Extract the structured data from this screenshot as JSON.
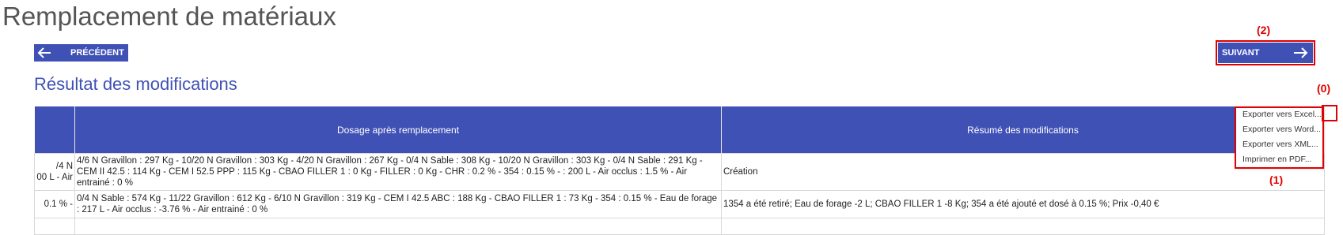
{
  "page": {
    "title": "Remplacement de matériaux"
  },
  "nav": {
    "prev_label": "PRÉCÉDENT",
    "next_label": "SUIVANT"
  },
  "section": {
    "title": "Résultat des modifications"
  },
  "table": {
    "headers": [
      "",
      "Dosage après remplacement",
      "Résumé des modifications"
    ],
    "rows": [
      {
        "c0": "/4 N\n00 L - Air",
        "c1": "4/6 N Gravillon : 297 Kg - 10/20 N Gravillon : 303 Kg - 4/20 N Gravillon : 267 Kg - 0/4 N Sable : 308 Kg - 10/20 N Gravillon : 303 Kg - 0/4 N Sable : 291 Kg - CEM II 42.5 : 114 Kg - CEM I 52.5 PPP : 115 Kg - CBAO FILLER 1 : 0 Kg - FILLER : 0 Kg - CHR : 0.2 % - 354 : 0.15 % - : 200 L - Air occlus : 1.5 % - Air entrainé : 0 %",
        "c2": "Création"
      },
      {
        "c0": "0.1 % -",
        "c1": "0/4 N Sable : 574 Kg - 11/22 Gravillon : 612 Kg - 6/10 N Gravillon : 319 Kg - CEM I 42.5 ABC : 188 Kg - CBAO FILLER 1 : 73 Kg - 354 : 0.15 % - Eau de forage : 217 L - Air occlus : -3.76 % - Air entrainé : 0 %",
        "c2": "1354 a été retiré; Eau de forage -2 L; CBAO FILLER 1 -8 Kg; 354 a été ajouté et dosé à 0.15 %; Prix -0,40 €"
      },
      {
        "c0": "",
        "c1": "",
        "c2": ""
      }
    ]
  },
  "export_menu": {
    "items": [
      "Exporter vers Excel...",
      "Exporter vers Word...",
      "Exporter vers XML...",
      "Imprimer en PDF..."
    ]
  },
  "annotations": {
    "a0": "(0)",
    "a1": "(1)",
    "a2": "(2)"
  },
  "colors": {
    "primary": "#3f51b5",
    "annotation": "#e00000"
  },
  "icons": {
    "prev": "arrow-left-icon",
    "next": "arrow-right-icon",
    "menu": "more-vertical-icon"
  }
}
